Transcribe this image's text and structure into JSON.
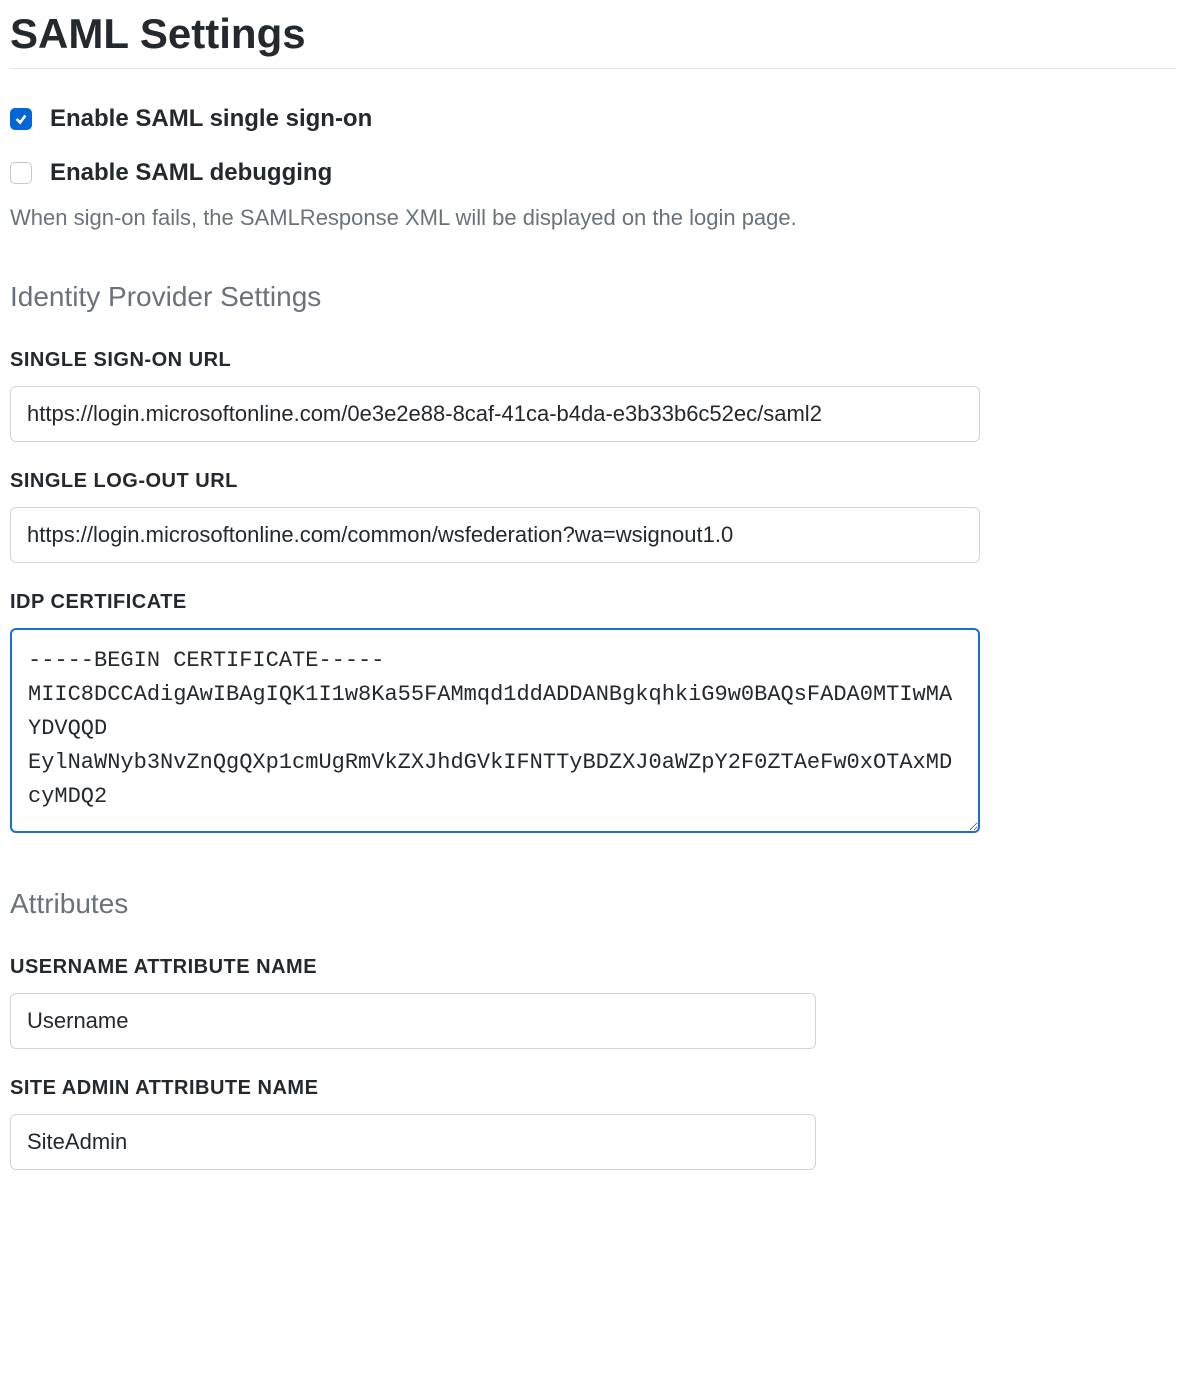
{
  "page_title": "SAML Settings",
  "checkboxes": {
    "enable_sso": {
      "label": "Enable SAML single sign-on",
      "checked": true
    },
    "enable_debug": {
      "label": "Enable SAML debugging",
      "checked": false,
      "help": "When sign-on fails, the SAMLResponse XML will be displayed on the login page."
    }
  },
  "idp_section": {
    "heading": "Identity Provider Settings",
    "sso_url": {
      "label": "SINGLE SIGN-ON URL",
      "value": "https://login.microsoftonline.com/0e3e2e88-8caf-41ca-b4da-e3b33b6c52ec/saml2"
    },
    "slo_url": {
      "label": "SINGLE LOG-OUT URL",
      "value": "https://login.microsoftonline.com/common/wsfederation?wa=wsignout1.0"
    },
    "certificate": {
      "label": "IDP CERTIFICATE",
      "value": "-----BEGIN CERTIFICATE-----\nMIIC8DCCAdigAwIBAgIQK1I1w8Ka55FAMmqd1ddADDANBgkqhkiG9w0BAQsFADA0MTIwMAYDVQQD\nEylNaWNyb3NvZnQgQXp1cmUgRmVkZXJhdGVkIFNTTyBDZXJ0aWZpY2F0ZTAeFw0xOTAxMDcyMDQ2"
    }
  },
  "attributes_section": {
    "heading": "Attributes",
    "username": {
      "label": "USERNAME ATTRIBUTE NAME",
      "value": "Username"
    },
    "site_admin": {
      "label": "SITE ADMIN ATTRIBUTE NAME",
      "value": "SiteAdmin"
    }
  }
}
